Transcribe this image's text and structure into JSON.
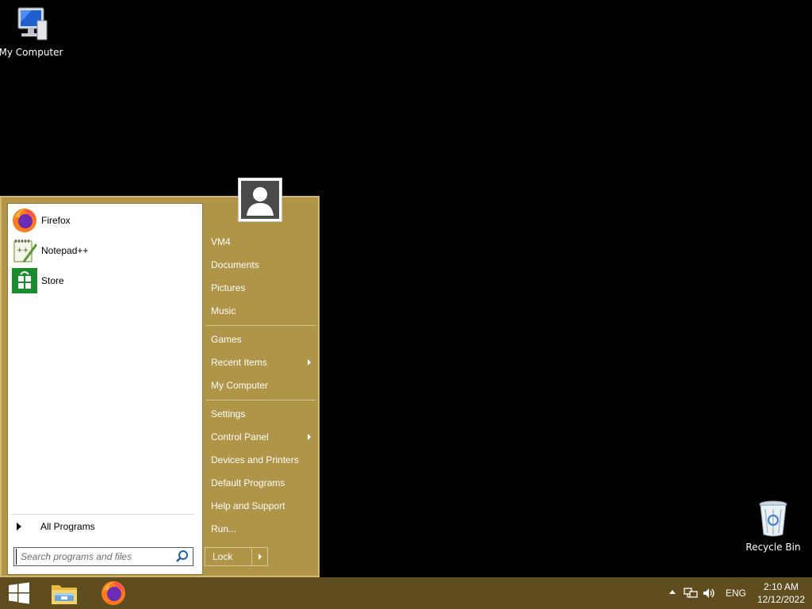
{
  "desktop": {
    "icons": [
      {
        "label": "My Computer",
        "icon": "computer-icon"
      },
      {
        "label": "Recycle Bin",
        "icon": "recycle-bin-icon"
      }
    ]
  },
  "start_menu": {
    "pinned": [
      {
        "label": "Firefox",
        "icon": "firefox-icon"
      },
      {
        "label": "Notepad++",
        "icon": "notepad-plus-plus-icon"
      },
      {
        "label": "Store",
        "icon": "store-icon"
      }
    ],
    "all_programs_label": "All Programs",
    "search_placeholder": "Search programs and files",
    "right_items": [
      {
        "label": "VM4"
      },
      {
        "label": "Documents"
      },
      {
        "label": "Pictures"
      },
      {
        "label": "Music"
      },
      {
        "label": "Games"
      },
      {
        "label": "Recent Items",
        "has_submenu": true
      },
      {
        "label": "My Computer"
      },
      {
        "label": "Settings"
      },
      {
        "label": "Control Panel",
        "has_submenu": true
      },
      {
        "label": "Devices and Printers"
      },
      {
        "label": "Default Programs"
      },
      {
        "label": "Help and Support"
      },
      {
        "label": "Run..."
      }
    ],
    "lock_label": "Lock"
  },
  "taskbar": {
    "buttons": [
      {
        "icon": "windows-start-icon"
      },
      {
        "icon": "file-explorer-icon"
      },
      {
        "icon": "firefox-icon"
      }
    ],
    "tray": {
      "language": "ENG",
      "time": "2:10 AM",
      "date": "12/12/2022"
    }
  },
  "colors": {
    "menu_bg": "#b09447",
    "taskbar_bg": "#5f4c1f",
    "desktop_bg": "#000000"
  }
}
